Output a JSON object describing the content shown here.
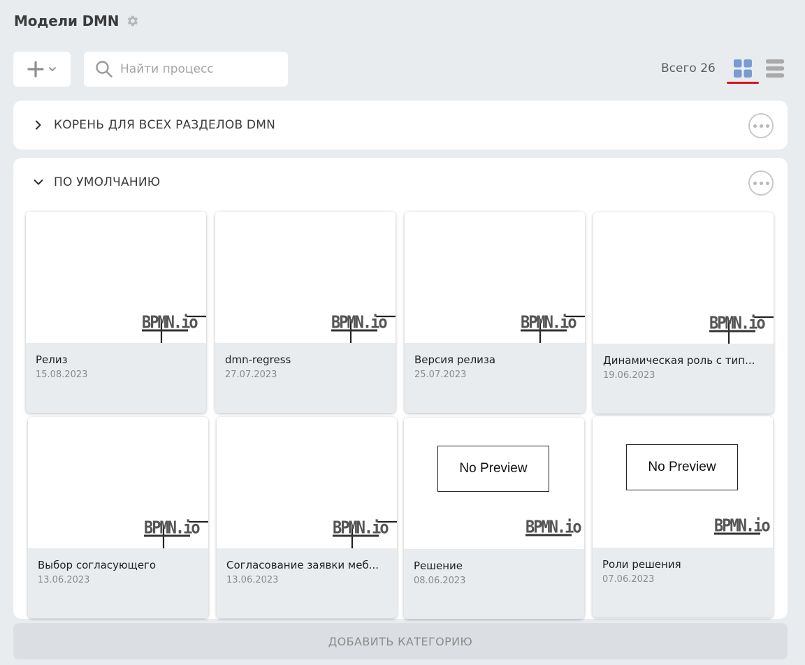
{
  "header": {
    "title": "Модели DMN",
    "settings_icon": "gear-icon"
  },
  "toolbar": {
    "add_icon": "plus-icon",
    "search_placeholder": "Найти процесс",
    "search_value": "",
    "total_label": "Всего 26",
    "active_view": "grid",
    "accent_color": "#d9141b",
    "grid_icon_color": "#7a9bd1"
  },
  "categories": [
    {
      "label": "КОРЕНЬ ДЛЯ ВСЕХ РАЗДЕЛОВ DMN",
      "expanded": false
    },
    {
      "label": "ПО УМОЛЧАНИЮ",
      "expanded": true,
      "cards": [
        {
          "name": "Релиз",
          "date": "15.08.2023",
          "preview": "bpmn-diagram"
        },
        {
          "name": "dmn-regress",
          "date": "27.07.2023",
          "preview": "bpmn-diagram"
        },
        {
          "name": "Версия релиза",
          "date": "25.07.2023",
          "preview": "bpmn-diagram"
        },
        {
          "name": "Динамическая роль с тип...",
          "date": "19.06.2023",
          "preview": "bpmn-diagram"
        },
        {
          "name": "Выбор согласующего",
          "date": "13.06.2023",
          "preview": "bpmn-diagram"
        },
        {
          "name": "Согласование заявки меб...",
          "date": "13.06.2023",
          "preview": "bpmn-diagram"
        },
        {
          "name": "Решение",
          "date": "08.06.2023",
          "preview": "no-preview",
          "no_preview_text": "No Preview"
        },
        {
          "name": "Роли решения",
          "date": "07.06.2023",
          "preview": "no-preview",
          "no_preview_text": "No Preview"
        }
      ]
    }
  ],
  "logo_text": "BPMN.io",
  "footer": {
    "add_category_label": "ДОБАВИТЬ КАТЕГОРИЮ"
  }
}
